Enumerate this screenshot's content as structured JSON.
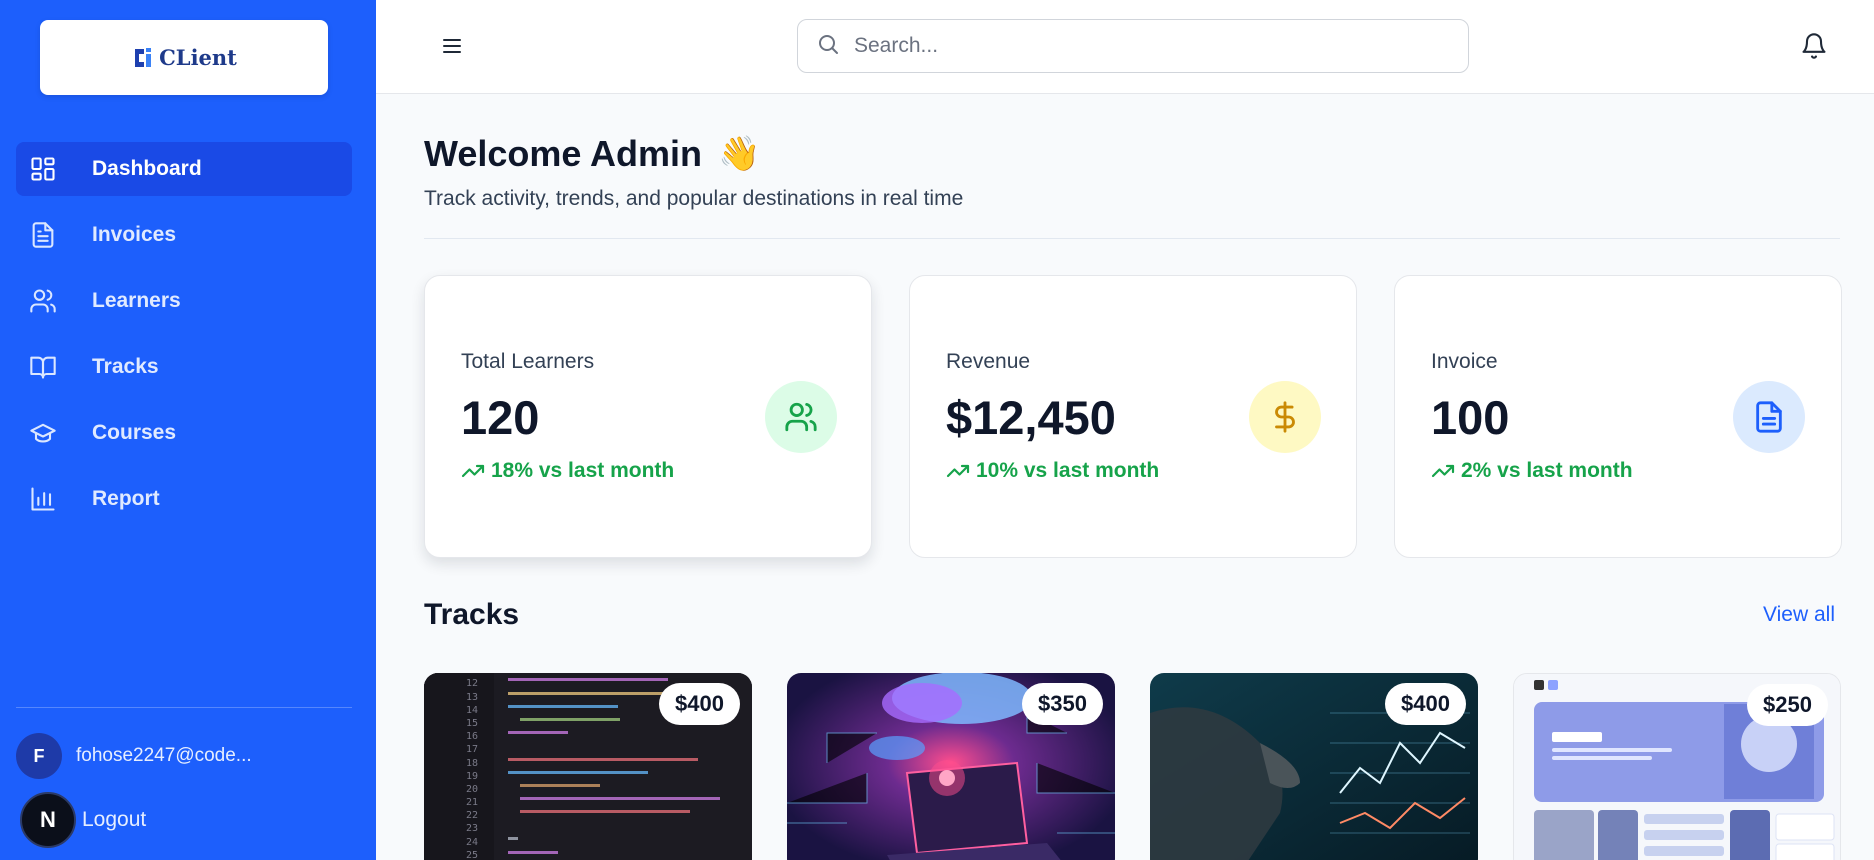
{
  "brand": {
    "logo_text": "CLient",
    "colors": {
      "sidebar": "#1d5ffc",
      "accent": "#1d5ffc",
      "positive": "#16a34a"
    }
  },
  "sidebar": {
    "items": [
      {
        "label": "Dashboard",
        "icon": "dashboard-icon",
        "active": true
      },
      {
        "label": "Invoices",
        "icon": "invoice-icon"
      },
      {
        "label": "Learners",
        "icon": "users-icon"
      },
      {
        "label": "Tracks",
        "icon": "book-open-icon"
      },
      {
        "label": "Courses",
        "icon": "graduation-cap-icon"
      },
      {
        "label": "Report",
        "icon": "bar-chart-icon"
      }
    ],
    "user": {
      "initial": "F",
      "email": "fohose2247@code..."
    },
    "logout": {
      "avatar_letter": "N",
      "label": "Logout"
    }
  },
  "header": {
    "search_placeholder": "Search..."
  },
  "main": {
    "welcome": "Welcome Admin",
    "wave": "👋",
    "subtitle": "Track activity, trends, and popular destinations in real time",
    "stats": [
      {
        "label": "Total Learners",
        "value": "120",
        "trend": "18% vs last month",
        "icon": "users-icon"
      },
      {
        "label": "Revenue",
        "value": "$12,450",
        "trend": "10% vs last month",
        "icon": "dollar-icon"
      },
      {
        "label": "Invoice",
        "value": "100",
        "trend": "2% vs last month",
        "icon": "document-icon"
      }
    ],
    "tracks_title": "Tracks",
    "view_all": "View all",
    "tracks": [
      {
        "price": "$400",
        "image": "code-editor-image"
      },
      {
        "price": "$350",
        "image": "cloud-laptop-image"
      },
      {
        "price": "$400",
        "image": "trading-chart-image"
      },
      {
        "price": "$250",
        "image": "web-ui-image"
      }
    ]
  }
}
